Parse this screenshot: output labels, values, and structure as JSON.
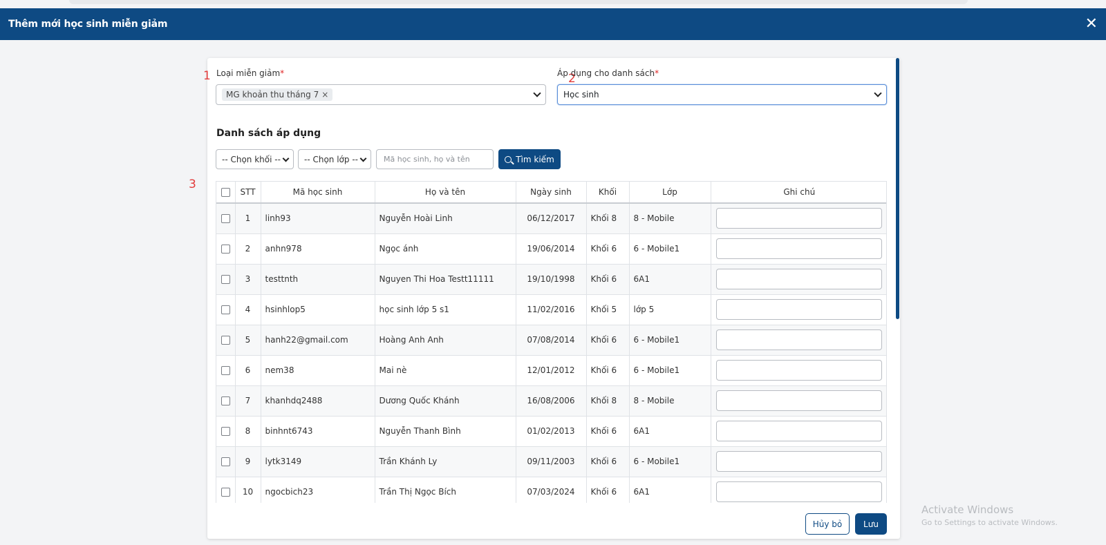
{
  "dialog": {
    "title": "Thêm mới học sinh miễn giảm",
    "close_icon": "close-icon"
  },
  "annotations": [
    "1",
    "2",
    "3"
  ],
  "form": {
    "discount_type": {
      "label": "Loại miễn giảm",
      "required": "*",
      "selected_chip": "MG khoản thu tháng 7",
      "chip_remove": "×"
    },
    "apply_list": {
      "label": "Áp dụng cho danh sách",
      "required": "*",
      "value": "Học sinh"
    }
  },
  "section": {
    "title": "Danh sách áp dụng"
  },
  "filters": {
    "grade_select": "-- Chọn khối --",
    "class_select": "-- Chọn lớp --",
    "search_placeholder": "Mã học sinh, họ và tên",
    "search_button": "Tìm kiếm"
  },
  "table": {
    "headers": [
      "STT",
      "Mã học sinh",
      "Họ và tên",
      "Ngày sinh",
      "Khối",
      "Lớp",
      "Ghi chú"
    ],
    "rows": [
      {
        "stt": "1",
        "code": "linh93",
        "name": "Nguyễn Hoài Linh",
        "dob": "06/12/2017",
        "grade": "Khối 8",
        "class": "8 - Mobile"
      },
      {
        "stt": "2",
        "code": "anhn978",
        "name": "Ngọc ánh",
        "dob": "19/06/2014",
        "grade": "Khối 6",
        "class": "6 - Mobile1"
      },
      {
        "stt": "3",
        "code": "testtnth",
        "name": "Nguyen Thi Hoa Testt11111",
        "dob": "19/10/1998",
        "grade": "Khối 6",
        "class": "6A1"
      },
      {
        "stt": "4",
        "code": "hsinhlop5",
        "name": "học sinh lớp 5 s1",
        "dob": "11/02/2016",
        "grade": "Khối 5",
        "class": "lớp 5"
      },
      {
        "stt": "5",
        "code": "hanh22@gmail.com",
        "name": "Hoàng Anh Anh",
        "dob": "07/08/2014",
        "grade": "Khối 6",
        "class": "6 - Mobile1"
      },
      {
        "stt": "6",
        "code": "nem38",
        "name": "Mai nè",
        "dob": "12/01/2012",
        "grade": "Khối 6",
        "class": "6 - Mobile1"
      },
      {
        "stt": "7",
        "code": "khanhdq2488",
        "name": "Dương Quốc Khánh",
        "dob": "16/08/2006",
        "grade": "Khối 8",
        "class": "8 - Mobile"
      },
      {
        "stt": "8",
        "code": "binhnt6743",
        "name": "Nguyễn Thanh Bình",
        "dob": "01/02/2013",
        "grade": "Khối 6",
        "class": "6A1"
      },
      {
        "stt": "9",
        "code": "lytk3149",
        "name": "Trần Khánh Ly",
        "dob": "09/11/2003",
        "grade": "Khối 6",
        "class": "6 - Mobile1"
      },
      {
        "stt": "10",
        "code": "ngocbich23",
        "name": "Trần Thị Ngọc Bích",
        "dob": "07/03/2024",
        "grade": "Khối 6",
        "class": "6A1"
      }
    ]
  },
  "footer": {
    "cancel": "Hủy bỏ",
    "save": "Lưu"
  },
  "watermark": {
    "line1": "Activate Windows",
    "line2": "Go to Settings to activate Windows."
  },
  "colors": {
    "primary": "#0e4a83",
    "annotation": "#e23b3b",
    "required": "#e02424"
  }
}
